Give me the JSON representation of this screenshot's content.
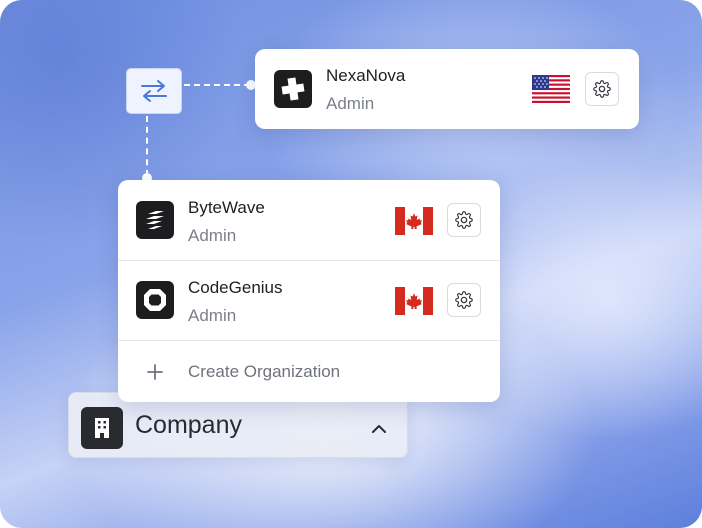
{
  "selected_org": {
    "name": "NexaNova",
    "role": "Admin",
    "flag": "us-flag",
    "logo_icon": "plus-icon"
  },
  "switch_icon": "swap-arrows-icon",
  "org_list": [
    {
      "name": "ByteWave",
      "role": "Admin",
      "flag": "canada-flag",
      "logo_icon": "layers-icon"
    },
    {
      "name": "CodeGenius",
      "role": "Admin",
      "flag": "canada-flag",
      "logo_icon": "octagon-ring-icon"
    }
  ],
  "create_org": {
    "label": "Create Organization",
    "icon": "plus-icon"
  },
  "company_selector": {
    "label": "Company",
    "icon": "building-icon",
    "chevron": "chevron-up-icon"
  },
  "colors": {
    "accent": "#4a78d8",
    "logo_bg": "#1d1d1f",
    "text": "#1f1f23",
    "muted": "#7b7f88"
  }
}
